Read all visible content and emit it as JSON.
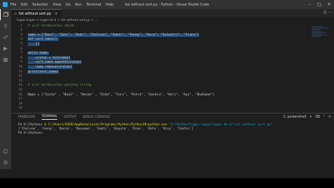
{
  "window": {
    "title": "list without sort.py - Python - Visual Studio Code",
    "menu": [
      "File",
      "Edit",
      "Selection",
      "View",
      "Go",
      "Run",
      "Terminal",
      "Help"
    ]
  },
  "tab": {
    "label": "list without sort.py",
    "icon": "python-file-icon"
  },
  "breadcrumb": "tugas tugas > tugas ke 4 > list without sort.py > ...",
  "editor": {
    "lines": [
      {
        "n": "1",
        "text": "# urut berdasarkan abjad"
      },
      {
        "n": "2",
        "text": ""
      },
      {
        "n": "3",
        "text": "nama = [\"Dani\", \"Zaki\", \"Andi\", \"Chelsea\", \"Sakti\", \"Fenny\", \"Hero\", \"Sulastri\", \"Frans\"]"
      },
      {
        "n": "4",
        "text": "def sort_nama():"
      },
      {
        "n": "5",
        "text": "    []"
      },
      {
        "n": "6",
        "text": ""
      },
      {
        "n": "7",
        "text": "while nama:"
      },
      {
        "n": "8",
        "text": "    urutan = min(nama)"
      },
      {
        "n": "9",
        "text": "    sort_nama.append(urutan)"
      },
      {
        "n": "10",
        "text": "    nama.remove(urutan)"
      },
      {
        "n": "11",
        "text": "print(sort_nama)"
      },
      {
        "n": "12",
        "text": ""
      },
      {
        "n": "13",
        "text": ""
      },
      {
        "n": "14",
        "text": "# urut berdasarkan panjang string"
      },
      {
        "n": "15",
        "text": ""
      },
      {
        "n": "16",
        "text": "Nama = [\"Sinta\" , \"Budi\" , \"Kenan\" , \"Dika\", \"Yuri\", \"Putra\", \"Saskia\", \"Heri\", \"Ayu\", \"Budiman\"]"
      },
      {
        "n": "17",
        "text": ""
      },
      {
        "n": "18",
        "text": ""
      },
      {
        "n": "19",
        "text": ""
      }
    ]
  },
  "panel": {
    "tabs": [
      "PROBLEMS",
      "TERMINAL",
      "OUTPUT",
      "DEBUG CONSOLE"
    ],
    "active_tab": "TERMINAL",
    "shell": "1: powershell",
    "terminal": {
      "prompt1": "PS D:\\Python> ",
      "cmd_exe": "& C:/Users/USER/AppData/Local/Programs/Python/Python39/python.exe",
      "cmd_arg": " \"d:/Python/tugas-tugas/tugas ke-4/list without sort.py\"",
      "output": "['Chelsea', 'Fenny', 'Dania', 'Kenanen', 'Sakti', 'Dayuta', 'Dian', 'Okta', 'Rizy', 'Yanfei']",
      "prompt2": "PS D:\\Python> "
    }
  }
}
